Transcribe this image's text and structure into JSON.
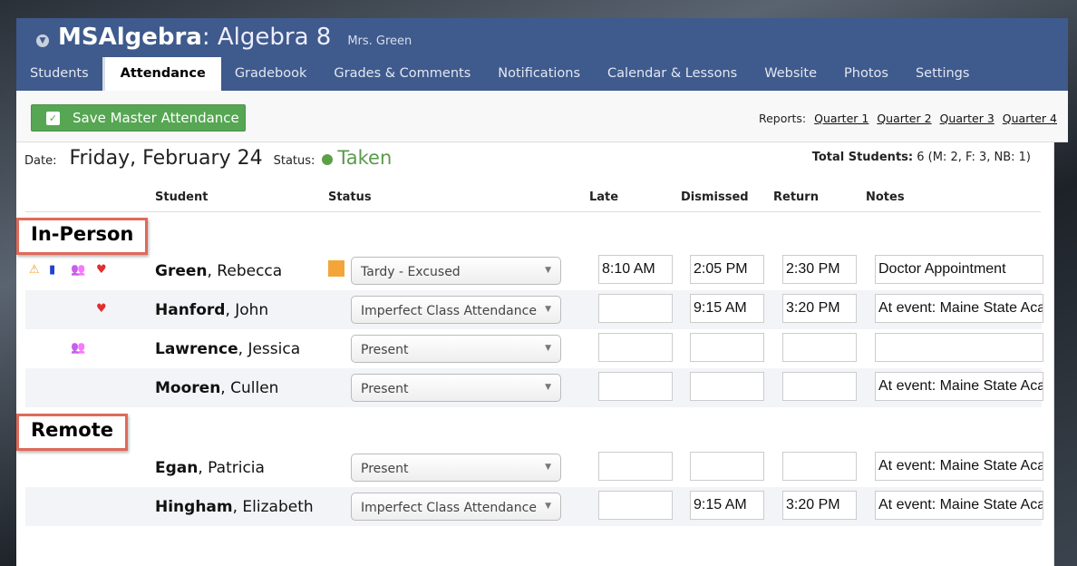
{
  "header": {
    "brand": "MSAlgebra",
    "course": ": Algebra 8",
    "teacher": "Mrs. Green"
  },
  "tabs": [
    "Students",
    "Attendance",
    "Gradebook",
    "Grades & Comments",
    "Notifications",
    "Calendar & Lessons",
    "Website",
    "Photos",
    "Settings"
  ],
  "active_tab": "Attendance",
  "toolbar": {
    "save_label": "Save Master Attendance",
    "reports_label": "Reports:",
    "reports": [
      "Quarter 1",
      "Quarter 2",
      "Quarter 3",
      "Quarter 4"
    ]
  },
  "summary": {
    "date_label": "Date:",
    "date": "Friday, February 24",
    "status_label": "Status:",
    "status": "Taken",
    "total_label": "Total Students:",
    "total": "6 (M: 2, F: 3, NB: 1)"
  },
  "columns": [
    "Student",
    "Status",
    "Late",
    "Dismissed",
    "Return",
    "Notes"
  ],
  "colors": {
    "header": "#3f5a8c",
    "save": "#56a653",
    "taken": "#5a9a4c",
    "tardy_marker": "#f4a53a",
    "group_border": "#e06a5a"
  },
  "groups": [
    {
      "label": "In-Person",
      "students": [
        {
          "last": "Green",
          "first": ", Rebecca",
          "icons": [
            "warning-icon",
            "notebook-icon",
            "group-icon",
            "heart-monitor-icon"
          ],
          "marker": true,
          "status": "Tardy - Excused",
          "late": "8:10 AM",
          "dismissed": "2:05 PM",
          "return": "2:30 PM",
          "notes": "Doctor Appointment"
        },
        {
          "last": "Hanford",
          "first": ", John",
          "icons": [
            "heart-monitor-icon"
          ],
          "status": "Imperfect Class Attendance",
          "late": "",
          "dismissed": "9:15 AM",
          "return": "3:20 PM",
          "notes": "At event: Maine State Academic"
        },
        {
          "last": "Lawrence",
          "first": ", Jessica",
          "icons": [
            "group-icon"
          ],
          "status": "Present",
          "late": "",
          "dismissed": "",
          "return": "",
          "notes": ""
        },
        {
          "last": "Mooren",
          "first": ", Cullen",
          "icons": [],
          "status": "Present",
          "late": "",
          "dismissed": "",
          "return": "",
          "notes": "At event: Maine State Academic"
        }
      ]
    },
    {
      "label": "Remote",
      "students": [
        {
          "last": "Egan",
          "first": ", Patricia",
          "icons": [],
          "status": "Present",
          "late": "",
          "dismissed": "",
          "return": "",
          "notes": "At event: Maine State Academic"
        },
        {
          "last": "Hingham",
          "first": ", Elizabeth",
          "icons": [],
          "status": "Imperfect Class Attendance",
          "late": "",
          "dismissed": "9:15 AM",
          "return": "3:20 PM",
          "notes": "At event: Maine State Academic"
        }
      ]
    }
  ]
}
